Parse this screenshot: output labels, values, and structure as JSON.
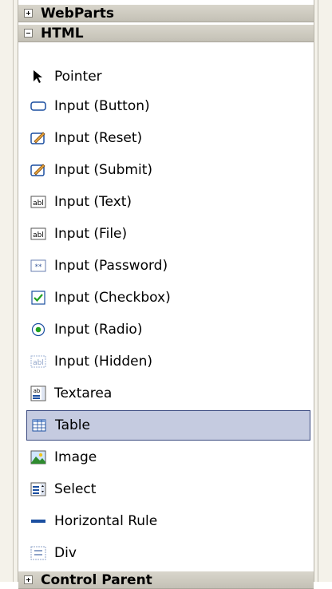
{
  "categories": {
    "webparts": "WebParts",
    "html": "HTML",
    "next_partial": "Control Parent"
  },
  "items": [
    {
      "label": "Pointer",
      "icon": "pointer-icon"
    },
    {
      "label": "Input (Button)",
      "icon": "button-icon"
    },
    {
      "label": "Input (Reset)",
      "icon": "reset-icon"
    },
    {
      "label": "Input (Submit)",
      "icon": "submit-icon"
    },
    {
      "label": "Input (Text)",
      "icon": "text-input-icon"
    },
    {
      "label": "Input (File)",
      "icon": "file-input-icon"
    },
    {
      "label": "Input (Password)",
      "icon": "password-icon"
    },
    {
      "label": "Input (Checkbox)",
      "icon": "checkbox-icon"
    },
    {
      "label": "Input (Radio)",
      "icon": "radio-icon"
    },
    {
      "label": "Input (Hidden)",
      "icon": "hidden-input-icon"
    },
    {
      "label": "Textarea",
      "icon": "textarea-icon"
    },
    {
      "label": "Table",
      "icon": "table-icon",
      "selected": true
    },
    {
      "label": "Image",
      "icon": "image-icon"
    },
    {
      "label": "Select",
      "icon": "select-icon"
    },
    {
      "label": "Horizontal Rule",
      "icon": "horizontal-rule-icon"
    },
    {
      "label": "Div",
      "icon": "div-icon"
    }
  ],
  "colors": {
    "selection_bg": "#c5cbe0",
    "selection_border": "#3b4a80",
    "header_bg": "#cfccc1"
  }
}
